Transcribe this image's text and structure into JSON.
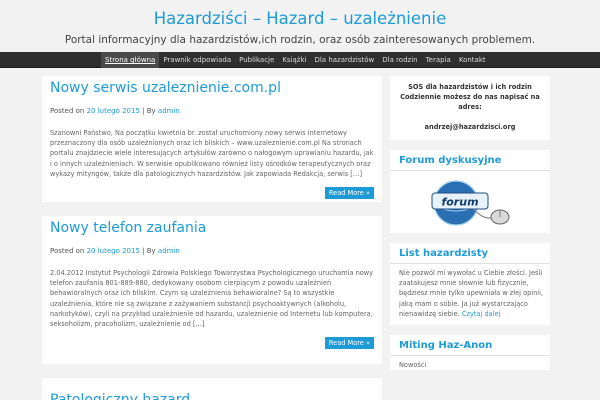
{
  "header": {
    "title": "Hazardziści – Hazard – uzależnienie",
    "description": "Portal informacyjny dla hazardzistów,ich rodzin, oraz osób zainteresowanych problemem."
  },
  "nav": {
    "items": [
      {
        "label": "Strona główna"
      },
      {
        "label": "Prawnik odpowiada"
      },
      {
        "label": "Publikacje"
      },
      {
        "label": "Książki"
      },
      {
        "label": "Dla hazardzistów"
      },
      {
        "label": "Dla rodzin"
      },
      {
        "label": "Terapia"
      },
      {
        "label": "Kontakt"
      }
    ]
  },
  "posts": [
    {
      "title": "Nowy serwis uzaleznienie.com.pl",
      "meta_prefix": "Posted on",
      "date": "20 lutego 2015",
      "separator": "| By",
      "author": "admin",
      "excerpt": "Szanowni Państwo, Na początku kwietnia br. został uruchomiony nowy serwis internetowy przeznaczony dla osób uzależnionych oraz ich bliskich – www.uzaleznienie.com.pl Na stronach portalu znajdziecie wiele interesujących artykułów zarówno o nałogowym uprawianiu hazardu, jak i o innych uzależnieniach. W serwisie opublikowano również listy ośrodków terapeutycznych oraz wykazy mityngów, także dla patologicznych hazardzistów. Jak zapowiada Redakcja, serwis […]",
      "read_more": "Read More »"
    },
    {
      "title": "Nowy telefon zaufania",
      "meta_prefix": "Posted on",
      "date": "20 lutego 2015",
      "separator": "| By",
      "author": "admin",
      "excerpt": "2.04.2012 Instytut Psychologii Zdrowia Polskiego Towarzystwa Psychologicznego uruchamia nowy telefon zaufania 801-889-880, dedykowany osobom cierpiącym z powodu uzależnień behawioralnych oraz ich bliskim. Czym są uzależnienia behawioralne? Są to wszystkie uzależnienia, które nie są związane z zażywaniem substancji psychoaktywnych (alkoholu, narkotyków), czyli na przykład uzależnienie od hazardu, uzależnienie od Internetu lub komputera, seksoholizm, pracoholizm, uzależnienie od […]",
      "read_more": "Read More »"
    },
    {
      "title": "Patologiczny hazard"
    }
  ],
  "sidebar": {
    "sos": {
      "text": "SOS dla hazardzistów i ich rodzin Codziennie możesz do nas napisać na adres:",
      "email": "andrzej@hazardzisci.org"
    },
    "forum": {
      "title": "Forum dyskusyjne",
      "image_label": "forum"
    },
    "list": {
      "title": "List hazardzisty",
      "text": "Nie pozwól mi wywołać u Ciebie złości. Jeśli zaatakujesz mnie słownie lub fizycznie, będziesz mnie tylko upewniała w złej opinii, jaką mam o sobie. Ja już wystarczająco nienawidzę siebie.",
      "link": "Czytaj dalej"
    },
    "miting": {
      "title": "Miting Haz-Anon",
      "text": "Nowości"
    }
  },
  "colors": {
    "accent": "#1e9bd7",
    "nav_bg": "#2f2f2f",
    "page_bg": "#f2f2f2"
  }
}
